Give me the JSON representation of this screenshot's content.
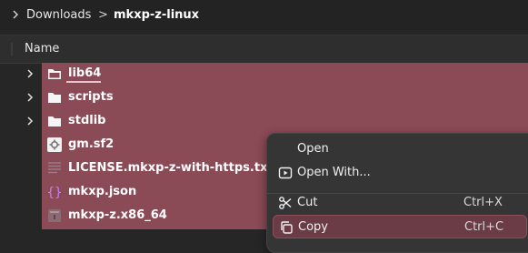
{
  "pathbar": {
    "crumbs": [
      "Downloads",
      "mkxp-z-linux"
    ],
    "separator": ">"
  },
  "columns": {
    "name_header": "Name"
  },
  "files": [
    {
      "name": "lib64",
      "type": "folder"
    },
    {
      "name": "scripts",
      "type": "folder"
    },
    {
      "name": "stdlib",
      "type": "folder"
    },
    {
      "name": "gm.sf2",
      "type": "file"
    },
    {
      "name": "LICENSE.mkxp-z-with-https.txt",
      "type": "text"
    },
    {
      "name": "mkxp.json",
      "type": "json"
    },
    {
      "name": "mkxp-z.x86_64",
      "type": "executable"
    }
  ],
  "context_menu": {
    "items": [
      {
        "label": "Open",
        "shortcut": ""
      },
      {
        "label": "Open With...",
        "shortcut": "",
        "icon": "open-with-icon"
      },
      {
        "label": "Cut",
        "shortcut": "Ctrl+X",
        "icon": "scissors-icon"
      },
      {
        "label": "Copy",
        "shortcut": "Ctrl+C",
        "icon": "copy-icon"
      }
    ]
  },
  "colors": {
    "selection": "#8a4a56",
    "menu_hover": "#6b3c45",
    "background": "#262626"
  }
}
